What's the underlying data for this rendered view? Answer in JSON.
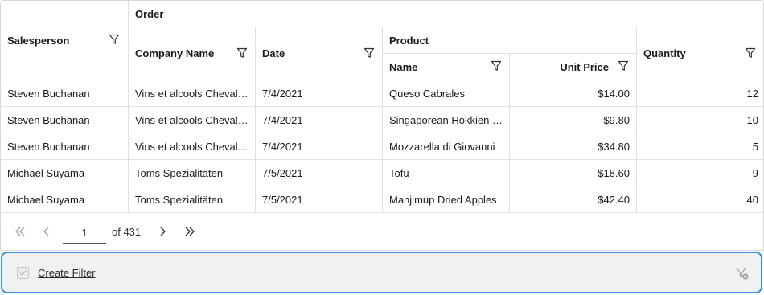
{
  "headers": {
    "salesperson": "Salesperson",
    "order": "Order",
    "company_name": "Company Name",
    "date": "Date",
    "product": "Product",
    "name": "Name",
    "unit_price": "Unit Price",
    "quantity": "Quantity"
  },
  "rows": [
    {
      "salesperson": "Steven Buchanan",
      "company": "Vins et alcools Chevalier",
      "date": "7/4/2021",
      "product": "Queso Cabrales",
      "price": "$14.00",
      "qty": "12"
    },
    {
      "salesperson": "Steven Buchanan",
      "company": "Vins et alcools Chevalier",
      "date": "7/4/2021",
      "product": "Singaporean Hokkien Fried Mee",
      "price": "$9.80",
      "qty": "10"
    },
    {
      "salesperson": "Steven Buchanan",
      "company": "Vins et alcools Chevalier",
      "date": "7/4/2021",
      "product": "Mozzarella di Giovanni",
      "price": "$34.80",
      "qty": "5"
    },
    {
      "salesperson": "Michael Suyama",
      "company": "Toms Spezialitäten",
      "date": "7/5/2021",
      "product": "Tofu",
      "price": "$18.60",
      "qty": "9"
    },
    {
      "salesperson": "Michael Suyama",
      "company": "Toms Spezialitäten",
      "date": "7/5/2021",
      "product": "Manjimup Dried Apples",
      "price": "$42.40",
      "qty": "40"
    }
  ],
  "pager": {
    "current_page": "1",
    "of_label": "of 431"
  },
  "filter_bar": {
    "create_filter_label": "Create Filter"
  },
  "icons": {
    "filter": "filter-icon",
    "first": "first-page-icon",
    "prev": "previous-page-icon",
    "next": "next-page-icon",
    "last": "last-page-icon",
    "check": "checkbox-icon",
    "clear": "clear-filter-icon"
  },
  "colors": {
    "accent": "#3c8ee0",
    "border": "#e0e0e0",
    "filterbar_bg": "#f1f1f1"
  }
}
